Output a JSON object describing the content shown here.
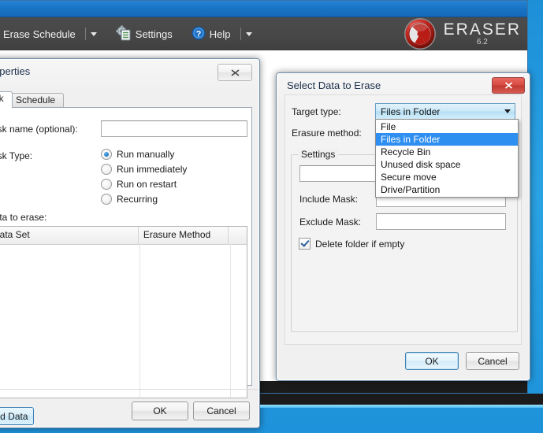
{
  "app": {
    "title": "",
    "toolbar": {
      "erase_schedule_label": "Erase Schedule",
      "settings_label": "Settings",
      "help_label": "Help"
    },
    "brand": {
      "name": "ERASER",
      "version": "6.2"
    }
  },
  "properties_dialog": {
    "title": "Properties",
    "close_label": "✖",
    "tabs": [
      {
        "label": "ask",
        "active": true
      },
      {
        "label": "Schedule",
        "active": false
      }
    ],
    "task_name_label": "Task name (optional):",
    "task_name_value": "",
    "task_type_label": "Task Type:",
    "task_types": [
      {
        "label": "Run manually",
        "selected": true
      },
      {
        "label": "Run immediately",
        "selected": false
      },
      {
        "label": "Run on restart",
        "selected": false
      },
      {
        "label": "Recurring",
        "selected": false
      }
    ],
    "data_to_erase_label": "Data to erase:",
    "grid_columns": [
      "Data Set",
      "Erasure Method"
    ],
    "grid_rows": [],
    "add_data_label": "Add Data",
    "ok_label": "OK",
    "cancel_label": "Cancel"
  },
  "select_data_dialog": {
    "title": "Select Data to Erase",
    "close_label": "✖",
    "target_type_label": "Target type:",
    "target_type_value": "Files in Folder",
    "target_type_options": [
      "File",
      "Files in Folder",
      "Recycle Bin",
      "Unused disk space",
      "Secure move",
      "Drive/Partition"
    ],
    "target_type_selected_index": 1,
    "erasure_method_label": "Erasure method:",
    "erasure_method_value": "",
    "settings_group_label": "Settings",
    "folder_value": "",
    "include_mask_label": "Include Mask:",
    "include_mask_value": "",
    "exclude_mask_label": "Exclude Mask:",
    "exclude_mask_value": "",
    "delete_folder_if_empty_label": "Delete folder if empty",
    "delete_folder_if_empty_checked": true,
    "ok_label": "OK",
    "cancel_label": "Cancel"
  },
  "colors": {
    "titlebar_blue": "#1872c4",
    "toolbar_gray": "#474747",
    "desktop_blue": "#2aa3e4",
    "highlight_blue": "#2f8ff0",
    "brand_red": "#c0241c"
  }
}
